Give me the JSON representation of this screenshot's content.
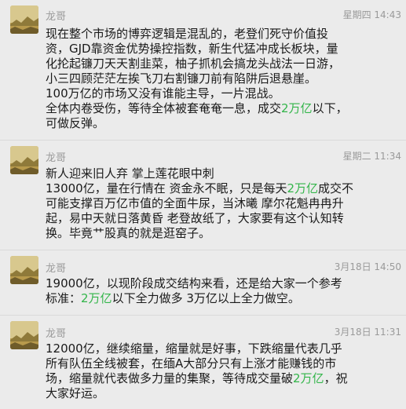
{
  "messages": [
    {
      "sender": "龙哥",
      "time": "星期四 14:43",
      "lines": [
        [
          "现在整个市场的博弈逻辑是混乱的，老登们死守价值投"
        ],
        [
          "资，GJD靠资金优势操控指数，新生代猛冲成长板块，量"
        ],
        [
          "化抡起镰刀天天割韭菜，柚子抓机会搞龙头战法一日游，"
        ],
        [
          "小三四顾茫茫左挨飞刀右割镰刀前有陷阱后退悬崖。"
        ],
        [
          "100万亿的市场又没有谁能主导，一片混战。"
        ],
        [
          "全体内卷受伤，等待全体被套奄奄一息，成交",
          {
            "hl": "2万亿"
          },
          "以下，"
        ],
        [
          "可做反弹。"
        ]
      ]
    },
    {
      "sender": "龙哥",
      "time": "星期二 11:34",
      "lines": [
        [
          "新人迎来旧人弃 掌上莲花眼中刺"
        ],
        [
          "13000亿，量在行情在 资金永不眠，只是每天",
          {
            "hl": "2万亿"
          },
          "成交不"
        ],
        [
          "可能支撑百万亿市值的全面牛尿，当沐曦 摩尔花魁冉冉升"
        ],
        [
          "起，易中天就日落黄昏 老登故纸了，大家要有这个认知转"
        ],
        [
          "换。毕竟艹股真的就是逛窑子。"
        ]
      ]
    },
    {
      "sender": "龙哥",
      "time": "3月18日 14:50",
      "lines": [
        [
          "19000亿，以现阶段成交结构来看，还是给大家一个参考"
        ],
        [
          "标准：",
          {
            "hl": "2万亿"
          },
          "以下全力做多 3万亿以上全力做空。"
        ]
      ]
    },
    {
      "sender": "龙哥",
      "time": "3月18日 11:31",
      "lines": [
        [
          "12000亿，继续缩量，缩量就是好事，下跌缩量代表几乎"
        ],
        [
          "所有队伍全线被套，在缅A大部分只有上涨才能赚钱的市"
        ],
        [
          "场，缩量就代表做多力量的集聚，等待成交量破",
          {
            "hl": "2万亿"
          },
          "，祝"
        ],
        [
          "大家好运。"
        ]
      ]
    }
  ]
}
